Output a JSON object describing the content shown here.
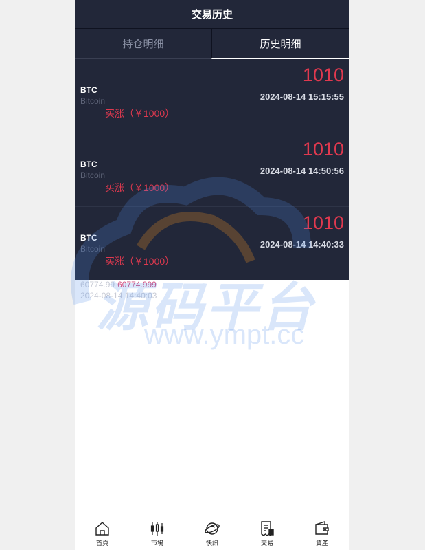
{
  "header": {
    "title": "交易历史"
  },
  "tabs": [
    {
      "label": "持仓明细",
      "active": false
    },
    {
      "label": "历史明细",
      "active": true
    }
  ],
  "records": [
    {
      "coin": "BTC",
      "fullname": "Bitcoin",
      "action": "买涨（￥1000）",
      "amount": "1010",
      "time": "2024-08-14 15:15:55"
    },
    {
      "coin": "BTC",
      "fullname": "Bitcoin",
      "action": "买涨（￥1000）",
      "amount": "1010",
      "time": "2024-08-14 14:50:56"
    },
    {
      "coin": "BTC",
      "fullname": "Bitcoin",
      "action": "买涨（￥1000）",
      "amount": "1010",
      "time": "2024-08-14 14:40:33"
    }
  ],
  "overflow": {
    "price1": "60774.99",
    "price2": "60774.999",
    "time": "2024-08-14 14:40:03"
  },
  "nav": [
    {
      "label": "首頁",
      "icon": "home-icon"
    },
    {
      "label": "市場",
      "icon": "candlestick-icon"
    },
    {
      "label": "快訊",
      "icon": "planet-icon"
    },
    {
      "label": "交易",
      "icon": "receipt-icon"
    },
    {
      "label": "資產",
      "icon": "wallet-icon"
    }
  ],
  "watermark": {
    "title": "源码平台",
    "url": "www.ympt.cc"
  },
  "colors": {
    "dark_bg": "#222739",
    "accent_red": "#e0394f",
    "watermark_blue": "#508ce6"
  }
}
